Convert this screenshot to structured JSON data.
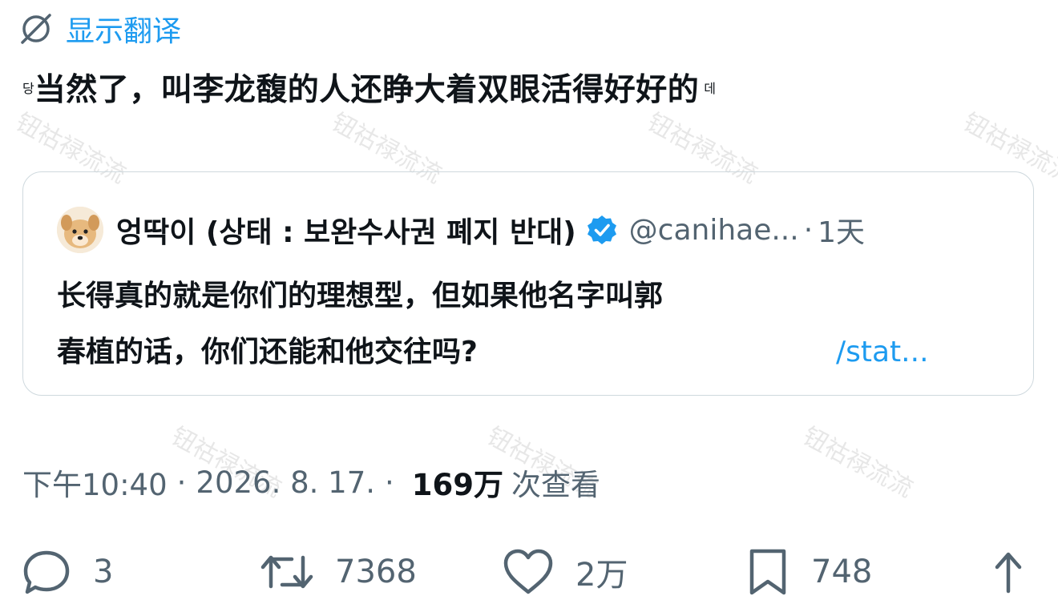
{
  "translate": {
    "label": "显示翻译"
  },
  "tweet": {
    "text_left_fragment": "당",
    "text": "当然了，叫李龙馥的人还睁大着双眼活得好好的",
    "text_right_fragment": "데"
  },
  "watermark": {
    "text": "钮祜禄流流"
  },
  "quote": {
    "author_name": "엉딱이 (상태 : 보완수사권 폐지 반대)",
    "handle": "@canihae...",
    "dot": "·",
    "time": "1天",
    "body_line1": "长得真的就是你们的理想型，但如果他名字叫郭",
    "body_line2": "春植的话，你们还能和他交往吗?",
    "link_fragment": "/stat..."
  },
  "meta": {
    "time": "下午10:40",
    "sep1": "·",
    "date": "2026. 8. 17.",
    "sep2": "·",
    "views_count": "169万",
    "views_label": "次查看"
  },
  "actions": {
    "reply_count": "3",
    "retweet_count": "7368",
    "like_count": "2万",
    "bookmark_count": "748"
  },
  "colors": {
    "accent": "#1d9bf0",
    "muted": "#536471",
    "text": "#0f1419",
    "border": "#cfd9de"
  }
}
